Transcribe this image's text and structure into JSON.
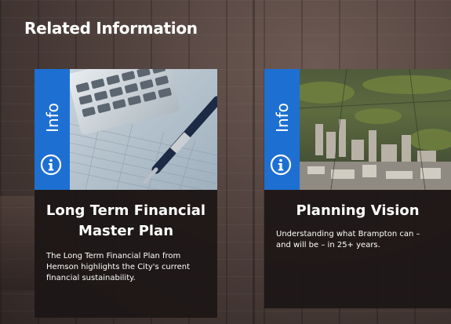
{
  "section": {
    "title": "Related Information"
  },
  "cards": [
    {
      "badge_label": "Info",
      "badge_icon": "info-circle-icon",
      "image": "calculator-and-pen-on-spreadsheet",
      "title": "Long Term Financial Master Plan",
      "description": "The Long Term Financial Plan from Hemson highlights the City's current financial sustainability."
    },
    {
      "badge_label": "Info",
      "badge_icon": "info-circle-icon",
      "image": "aerial-city-view",
      "title": "Planning Vision",
      "description": "Understanding what Brampton can – and will be – in 25+ years."
    }
  ],
  "colors": {
    "accent": "#1e6fd2",
    "card_bg": "#1c1616",
    "text": "#ffffff"
  }
}
